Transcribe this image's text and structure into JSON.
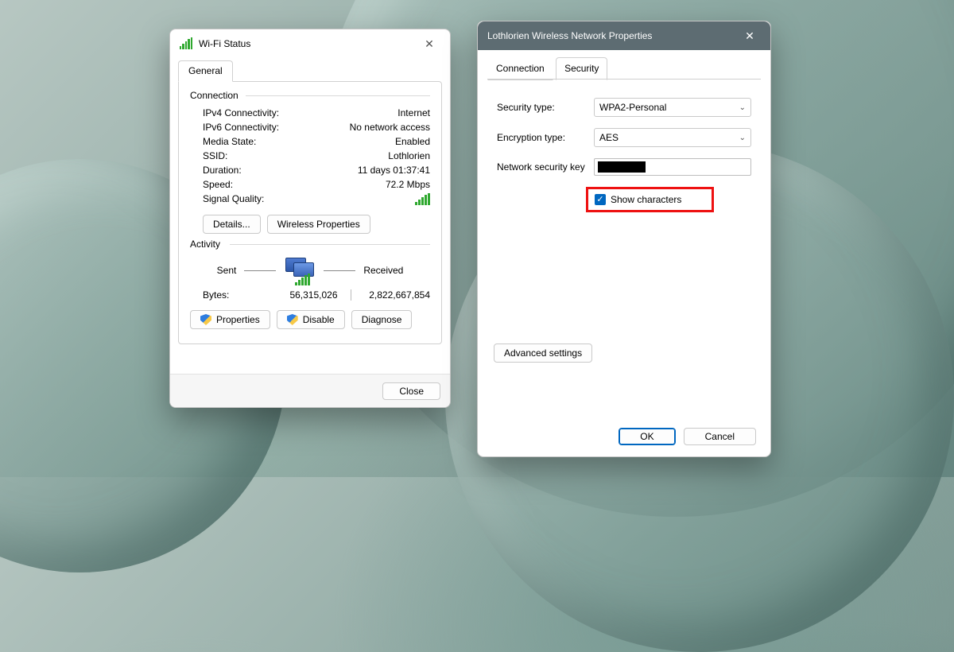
{
  "status_window": {
    "title": "Wi-Fi Status",
    "tab_general": "General",
    "group_connection": "Connection",
    "fields": {
      "ipv4_label": "IPv4 Connectivity:",
      "ipv4_value": "Internet",
      "ipv6_label": "IPv6 Connectivity:",
      "ipv6_value": "No network access",
      "media_label": "Media State:",
      "media_value": "Enabled",
      "ssid_label": "SSID:",
      "ssid_value": "Lothlorien",
      "duration_label": "Duration:",
      "duration_value": "11 days 01:37:41",
      "speed_label": "Speed:",
      "speed_value": "72.2 Mbps",
      "sigq_label": "Signal Quality:"
    },
    "buttons": {
      "details": "Details...",
      "wprops": "Wireless Properties"
    },
    "group_activity": "Activity",
    "activity": {
      "sent_label": "Sent",
      "received_label": "Received",
      "bytes_label": "Bytes:",
      "bytes_sent": "56,315,026",
      "bytes_received": "2,822,667,854"
    },
    "buttons2": {
      "properties": "Properties",
      "disable": "Disable",
      "diagnose": "Diagnose"
    },
    "close_btn": "Close"
  },
  "props_window": {
    "title": "Lothlorien Wireless Network Properties",
    "tabs": {
      "connection": "Connection",
      "security": "Security"
    },
    "security": {
      "type_label": "Security type:",
      "type_value": "WPA2-Personal",
      "enc_label": "Encryption type:",
      "enc_value": "AES",
      "key_label": "Network security key",
      "show_chars": "Show characters"
    },
    "advanced_btn": "Advanced settings",
    "ok_btn": "OK",
    "cancel_btn": "Cancel"
  }
}
